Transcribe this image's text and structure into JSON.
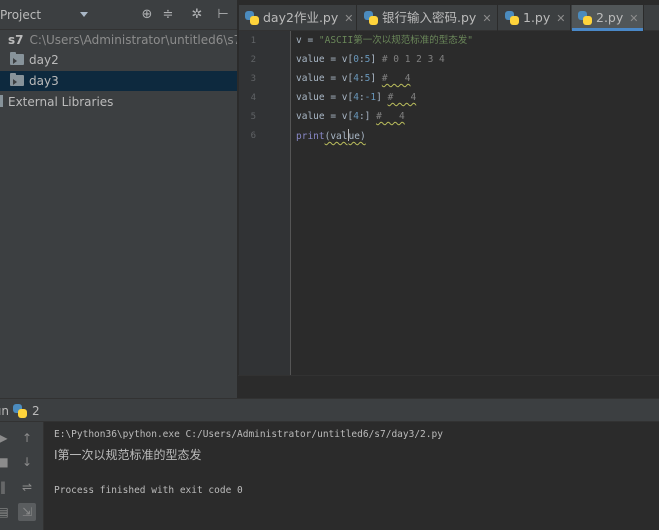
{
  "project_panel": {
    "title": "Project",
    "root": {
      "name": "s7",
      "path": "C:\\Users\\Administrator\\untitled6\\s7"
    },
    "folders": [
      {
        "label": "day2"
      },
      {
        "label": "day3"
      }
    ],
    "libraries": "External Libraries",
    "selected": "day3"
  },
  "tabs": [
    {
      "label": "day2作业.py",
      "active": false
    },
    {
      "label": "银行输入密码.py",
      "active": false
    },
    {
      "label": "1.py",
      "active": false
    },
    {
      "label": "2.py",
      "active": true
    }
  ],
  "editor": {
    "line_numbers": [
      "1",
      "2",
      "3",
      "4",
      "5",
      "6"
    ],
    "lines": [
      {
        "t1": "v = ",
        "str": "\"ASCII第一次以规范标准的型态发\""
      },
      {
        "t1": "value = v[",
        "n1": "0",
        "t2": ":",
        "n2": "5",
        "t3": "] ",
        "cmt": "# 0 1 2 3 4"
      },
      {
        "t1": "value = v[",
        "n1": "4",
        "t2": ":",
        "n2": "5",
        "t3": "] ",
        "cmt": "#   4"
      },
      {
        "t1": "value = v[",
        "n1": "4",
        "t2": ":",
        "n2": "-1",
        "t3": "] ",
        "cmt": "#   4"
      },
      {
        "t1": "value = v[",
        "n1": "4",
        "t2": ":",
        "n2": "",
        "t3": "] ",
        "cmt": "#   4"
      },
      {
        "fn": "print",
        "a": "(val",
        "b": "ue)"
      }
    ]
  },
  "run": {
    "label": "Run",
    "config_name": "2",
    "console": [
      "E:\\Python36\\python.exe C:/Users/Administrator/untitled6/s7/day3/2.py",
      "I第一次以规范标准的型态发",
      "",
      "Process finished with exit code 0"
    ]
  },
  "colors": {
    "panel": "#3c3f41",
    "editor_bg": "#2b2b2b",
    "selection": "#0d293e",
    "tab_underline": "#4a88c7",
    "string": "#6a8759",
    "number": "#6897bb",
    "comment": "#808080"
  },
  "icons": [
    "globe-target-icon",
    "collapse-icon",
    "gear-icon",
    "hide-panel-icon",
    "python-file-icon",
    "folder-icon",
    "rerun-icon",
    "stop-icon",
    "scroll-to-end-icon",
    "soft-wrap-icon"
  ]
}
